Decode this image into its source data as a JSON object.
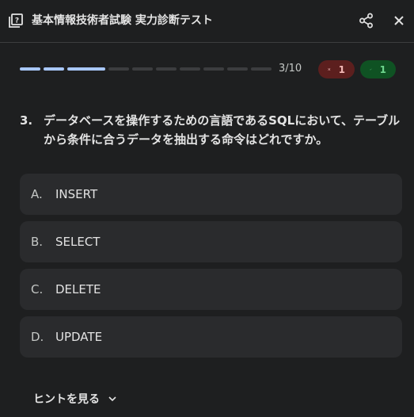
{
  "header": {
    "title": "基本情報技術者試験 実力診断テスト",
    "icons": {
      "quiz": "quiz-icon",
      "share": "share-icon",
      "close": "close-icon"
    }
  },
  "progress": {
    "current": 3,
    "total": 10,
    "label": "3/10",
    "wrong_count": "1",
    "correct_count": "1"
  },
  "question": {
    "number": "3.",
    "text": "データベースを操作するための言語であるSQLにおいて、テーブルから条件に合うデータを抽出する命令はどれですか。"
  },
  "options": [
    {
      "letter": "A.",
      "text": "INSERT"
    },
    {
      "letter": "B.",
      "text": "SELECT"
    },
    {
      "letter": "C.",
      "text": "DELETE"
    },
    {
      "letter": "D.",
      "text": "UPDATE"
    }
  ],
  "hint": {
    "label": "ヒントを見る"
  },
  "colors": {
    "background": "#1e1f20",
    "option_bg": "#2a2b2d",
    "progress_done": "#a8c7fa",
    "progress_todo": "#3c3d3f",
    "wrong_bg": "#5c1f1e",
    "wrong_fg": "#f2b8b5",
    "correct_bg": "#0f5223",
    "correct_fg": "#6dd58c"
  }
}
